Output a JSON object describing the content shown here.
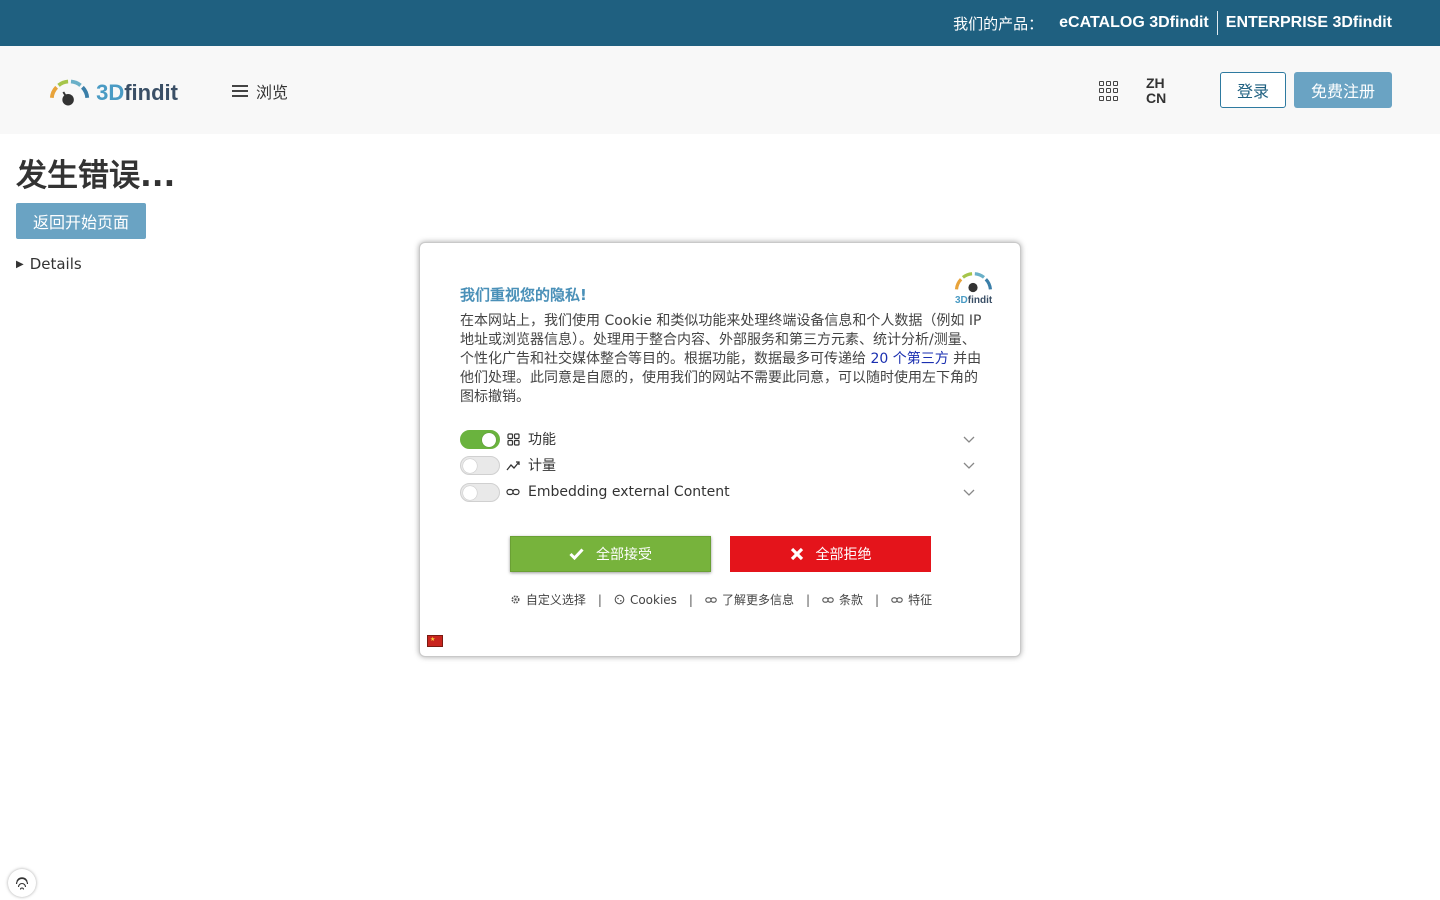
{
  "topbar": {
    "products_label": "我们的产品：",
    "products": [
      "eCATALOG 3Dfindit",
      "ENTERPRISE 3Dfindit"
    ]
  },
  "header": {
    "logo_part_a": "3D",
    "logo_part_b": "findit",
    "browse_label": "浏览",
    "lang_line1": "ZH",
    "lang_line2": "CN",
    "login_label": "登录",
    "register_label": "免费注册"
  },
  "error": {
    "title": "发生错误...",
    "home_button": "返回开始页面",
    "details_label": "Details"
  },
  "cookie": {
    "title": "我们重视您的隐私!",
    "text_before": "在本网站上，我们使用 Cookie 和类似功能来处理终端设备信息和个人数据（例如 IP 地址或浏览器信息）。处理用于整合内容、外部服务和第三方元素、统计分析/测量、个性化广告和社交媒体整合等目的。根据功能，数据最多可传递给 ",
    "partners_link": "20 个第三方",
    "text_after": " 并由他们处理。此同意是自愿的，使用我们的网站不需要此同意，可以随时使用左下角的图标撤销。",
    "options": [
      {
        "label": "功能",
        "enabled": true,
        "icon": "grid-icon"
      },
      {
        "label": "计量",
        "enabled": false,
        "icon": "chart-trend-icon"
      },
      {
        "label": "Embedding external Content",
        "enabled": false,
        "icon": "link-icon"
      }
    ],
    "accept_label": "全部接受",
    "reject_label": "全部拒绝",
    "links": [
      "自定义选择",
      "Cookies",
      "了解更多信息",
      "条款",
      "特征"
    ],
    "accept_color": "#77b33c",
    "reject_color": "#e4141b"
  },
  "colors": {
    "topbar": "#1f6080",
    "primary_button": "#6aa3c3",
    "accent": "#4a90b8"
  }
}
